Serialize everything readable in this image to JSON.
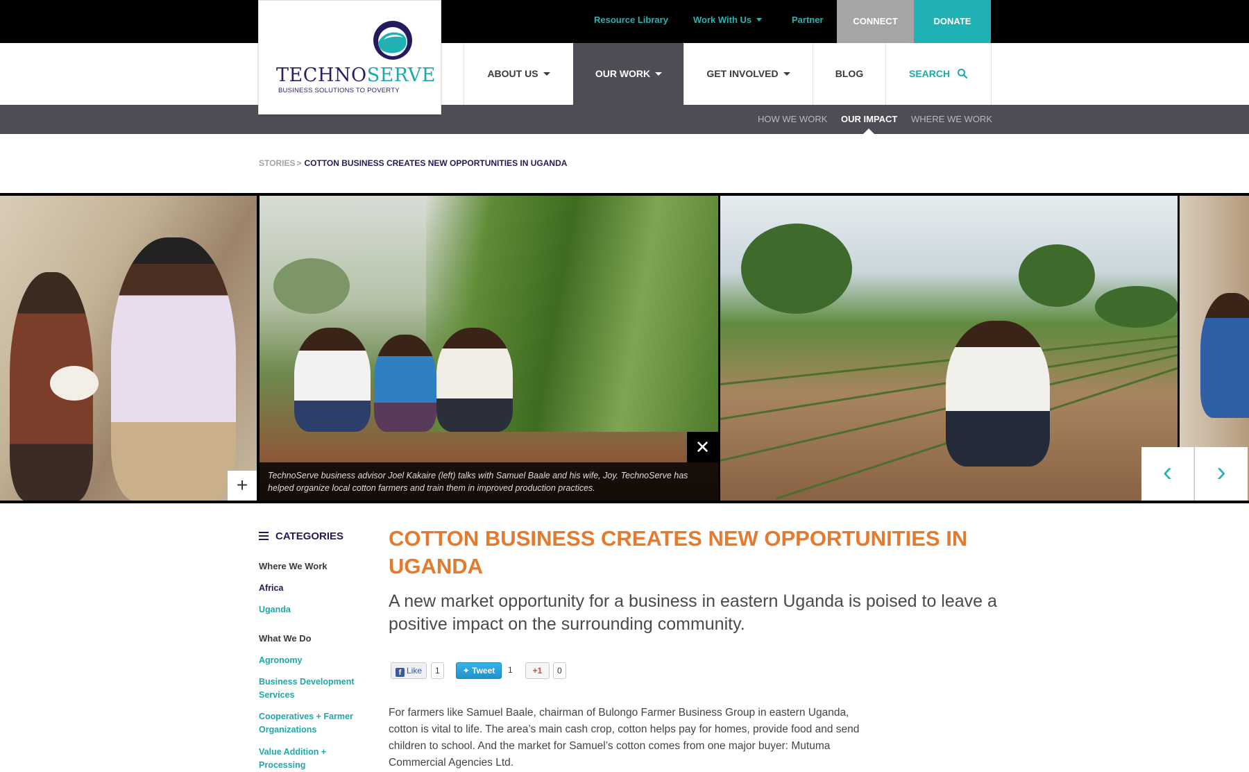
{
  "utility_nav": {
    "resource_library": "Resource Library",
    "work_with_us": "Work With Us",
    "partner": "Partner",
    "connect": "CONNECT",
    "donate": "DONATE"
  },
  "logo": {
    "word_left": "TECHNO",
    "word_right": "SERVE",
    "tagline": "BUSINESS SOLUTIONS TO POVERTY"
  },
  "main_nav": {
    "about_us": "ABOUT US",
    "our_work": "OUR WORK",
    "get_involved": "GET INVOLVED",
    "blog": "BLOG",
    "search": "SEARCH"
  },
  "sub_nav": {
    "how_we_work": "HOW WE WORK",
    "our_impact": "OUR IMPACT",
    "where_we_work": "WHERE WE WORK"
  },
  "breadcrumb": {
    "stories": "STORIES",
    "separator": ">",
    "current": "COTTON BUSINESS CREATES NEW OPPORTUNITIES IN UGANDA"
  },
  "gallery": {
    "caption": "TechnoServe business advisor Joel Kakaire (left) talks with Samuel Baale and his wife, Joy. TechnoServe has helped organize local cotton farmers and train them in improved production practices.",
    "close_glyph": "✕",
    "expand_glyph": "+",
    "prev_glyph": "‹",
    "next_glyph": "›"
  },
  "sidebar": {
    "categories": "CATEGORIES",
    "where_we_work": "Where We Work",
    "africa": "Africa",
    "uganda": "Uganda",
    "what_we_do": "What We Do",
    "agronomy": "Agronomy",
    "bds": "Business Development Services",
    "coops": "Cooperatives + Farmer Organizations",
    "value_addition": "Value Addition + Processing"
  },
  "article": {
    "title": "COTTON BUSINESS CREATES NEW OPPORTUNITIES IN UGANDA",
    "deck": "A new market opportunity for a business in eastern Uganda is poised to leave a positive impact on the surrounding community.",
    "body": "For farmers like Samuel Baale, chairman of Bulongo Farmer Business Group in eastern Uganda, cotton is vital to life. The area’s main cash crop, cotton helps pay for homes, provide food and send children to school. And the market for Samuel’s cotton comes from one major buyer: Mutuma Commercial Agencies Ltd."
  },
  "social": {
    "like": "Like",
    "like_count": "1",
    "tweet": "Tweet",
    "tweet_count": "1",
    "gplus": "+1",
    "gplus_count": "0"
  },
  "colors": {
    "teal": "#1fb1b3",
    "navy": "#241b55",
    "orange": "#e57a2c",
    "subnav_bg": "#4d4d55"
  }
}
